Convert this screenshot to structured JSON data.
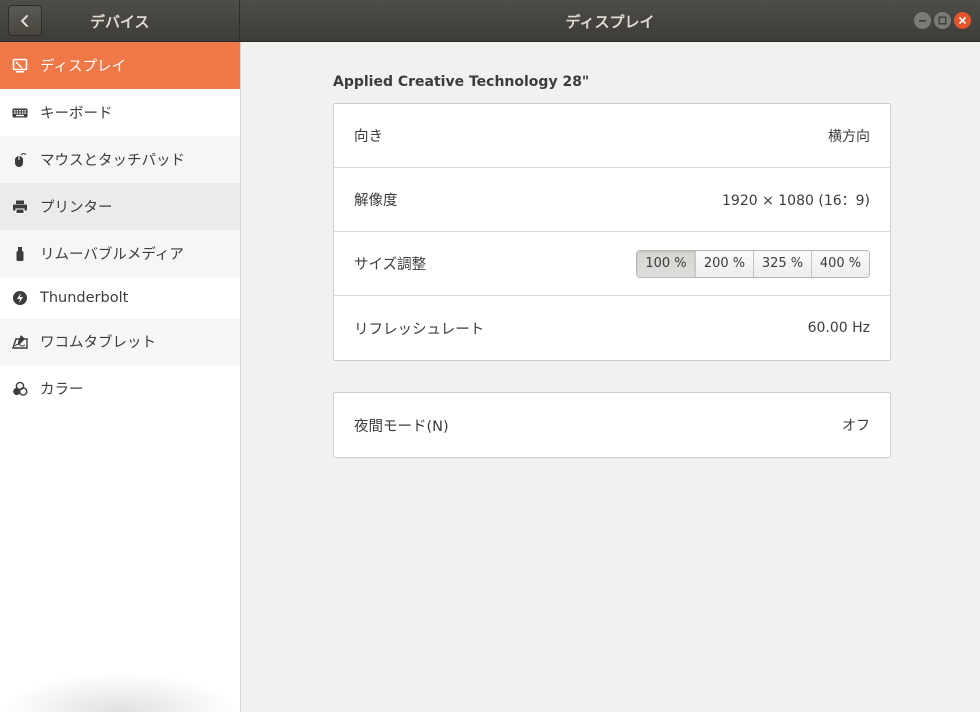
{
  "header": {
    "left_title": "デバイス",
    "title": "ディスプレイ"
  },
  "sidebar": {
    "items": [
      {
        "label": "ディスプレイ",
        "icon": "display-icon",
        "active": true
      },
      {
        "label": "キーボード",
        "icon": "keyboard-icon"
      },
      {
        "label": "マウスとタッチパッド",
        "icon": "mouse-icon"
      },
      {
        "label": "プリンター",
        "icon": "printer-icon"
      },
      {
        "label": "リムーバブルメディア",
        "icon": "usb-drive-icon"
      },
      {
        "label": "Thunderbolt",
        "icon": "thunderbolt-icon"
      },
      {
        "label": "ワコムタブレット",
        "icon": "tablet-icon"
      },
      {
        "label": "カラー",
        "icon": "color-icon"
      }
    ]
  },
  "main": {
    "monitor_name": "Applied Creative Technology 28\"",
    "rows": {
      "orientation": {
        "label": "向き",
        "value": "横方向"
      },
      "resolution": {
        "label": "解像度",
        "value": "1920 × 1080 (16：9)"
      },
      "scale": {
        "label": "サイズ調整",
        "options": [
          "100 %",
          "200 %",
          "325 %",
          "400 %"
        ],
        "selected": "100 %"
      },
      "refresh": {
        "label": "リフレッシュレート",
        "value": "60.00 Hz"
      }
    },
    "night_mode": {
      "label": "夜間モード(N)",
      "value": "オフ"
    }
  },
  "colors": {
    "accent": "#f07746",
    "headerbar": "#45433f",
    "close": "#e6542b"
  }
}
